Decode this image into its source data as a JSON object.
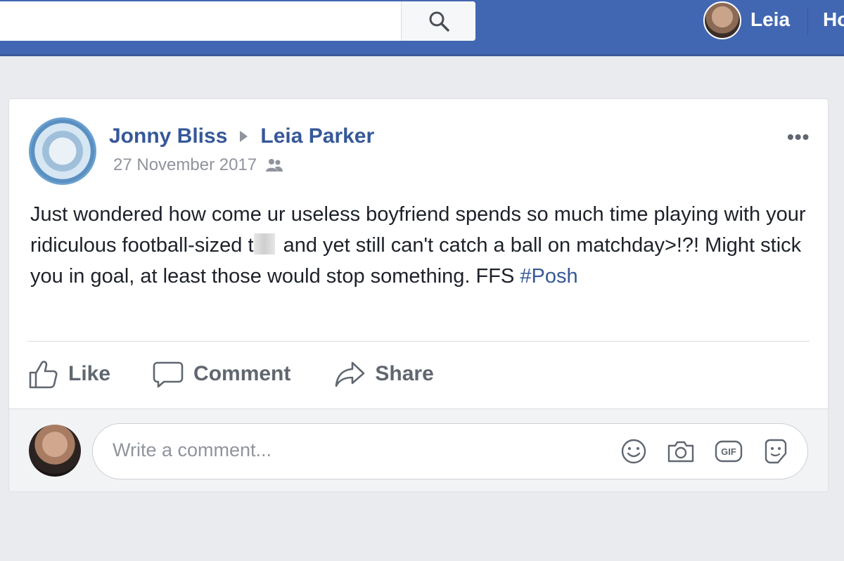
{
  "topbar": {
    "user_name": "Leia",
    "home_label": "Ho"
  },
  "post": {
    "author": "Jonny Bliss",
    "target": "Leia Parker",
    "date": "27 November 2017",
    "audience_icon": "friends-icon",
    "text_1": "Just wondered how come ur useless boyfriend spends so much time playing with your ridiculous football-sized t",
    "text_2": " and yet still can't catch a ball on matchday>!?! Might stick you in goal, at least those would stop something. FFS ",
    "hashtag": "#Posh",
    "more_label": "•••"
  },
  "actions": {
    "like": "Like",
    "comment": "Comment",
    "share": "Share"
  },
  "comment_box": {
    "placeholder": "Write a comment...",
    "icons": [
      "emoji-icon",
      "camera-icon",
      "gif-icon",
      "sticker-icon"
    ]
  },
  "colors": {
    "brand_blue": "#4267b2",
    "link_blue": "#365899",
    "muted_text": "#90949c",
    "action_text": "#606770"
  }
}
